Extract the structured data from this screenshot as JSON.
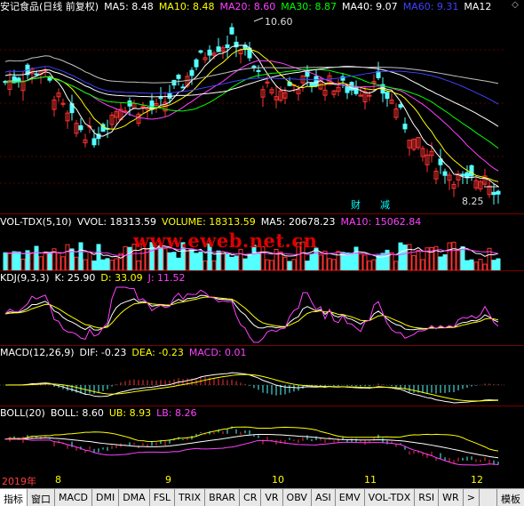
{
  "main": {
    "stock_title": "安记食品(日线 前复权)",
    "indicators": [
      {
        "label": "MA5: 8.48",
        "color": "#ffffff"
      },
      {
        "label": "MA10: 8.48",
        "color": "#ffff00"
      },
      {
        "label": "MA20: 8.60",
        "color": "#ff40ff"
      },
      {
        "label": "MA30: 8.87",
        "color": "#00ff00"
      },
      {
        "label": "MA40: 9.07",
        "color": "#ffffff"
      },
      {
        "label": "MA60: 9.31",
        "color": "#4040ff"
      },
      {
        "label": "MA12",
        "color": "#ffffff"
      }
    ],
    "high_label": "10.60",
    "low_label": "8.25",
    "markers": [
      "财",
      "减"
    ],
    "scroll_icon": "diamond-icon"
  },
  "vol": {
    "name": "VOL-TDX(5,10)",
    "items": [
      {
        "label": "VVOL: 18313.59",
        "color": "#ffffff"
      },
      {
        "label": "VOLUME: 18313.59",
        "color": "#ffff00"
      },
      {
        "label": "MA5: 20678.23",
        "color": "#ffffff"
      },
      {
        "label": "MA10: 15062.84",
        "color": "#ff40ff"
      }
    ]
  },
  "watermark": "www.eweb.net.cn",
  "kdj": {
    "name": "KDJ(9,3,3)",
    "items": [
      {
        "label": "K: 25.90",
        "color": "#ffffff"
      },
      {
        "label": "D: 33.09",
        "color": "#ffff00"
      },
      {
        "label": "J: 11.52",
        "color": "#ff40ff"
      }
    ]
  },
  "macd": {
    "name": "MACD(12,26,9)",
    "items": [
      {
        "label": "DIF: -0.23",
        "color": "#ffffff"
      },
      {
        "label": "DEA: -0.23",
        "color": "#ffff00"
      },
      {
        "label": "MACD: 0.01",
        "color": "#ff40ff"
      }
    ]
  },
  "boll": {
    "name": "BOLL(20)",
    "items": [
      {
        "label": "BOLL: 8.60",
        "color": "#ffffff"
      },
      {
        "label": "UB: 8.93",
        "color": "#ffff00"
      },
      {
        "label": "LB: 8.26",
        "color": "#ff40ff"
      }
    ]
  },
  "dates": [
    {
      "label": "2019年",
      "color": "#ff4040"
    },
    {
      "label": "8",
      "color": "#ffff00"
    },
    {
      "label": "9",
      "color": "#ffff00"
    },
    {
      "label": "10",
      "color": "#ffff00"
    },
    {
      "label": "11",
      "color": "#ffff00"
    },
    {
      "label": "12",
      "color": "#ffff00"
    }
  ],
  "tabs": [
    "指标",
    "窗口",
    "MACD",
    "DMI",
    "DMA",
    "FSL",
    "TRIX",
    "BRAR",
    "CR",
    "VR",
    "OBV",
    "ASI",
    "EMV",
    "VOL-TDX",
    "RSI",
    "WR",
    ">"
  ],
  "template_label": "模板"
}
